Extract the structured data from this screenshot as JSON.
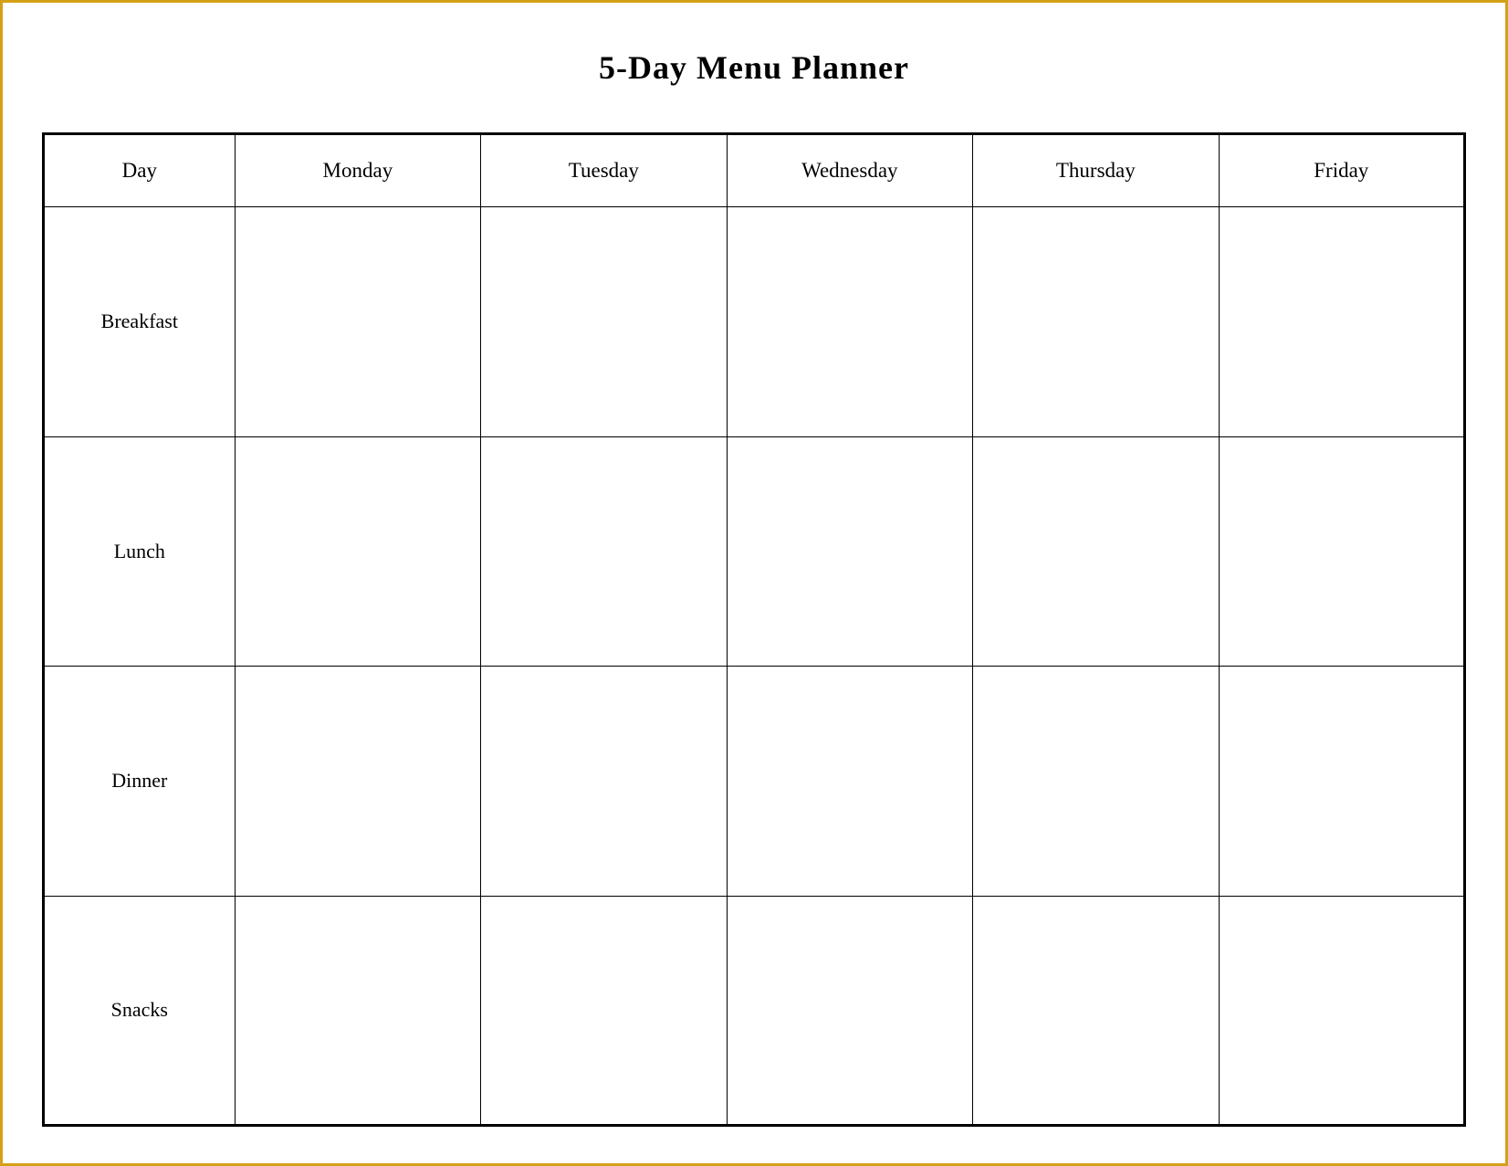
{
  "title": "5-Day Menu Planner",
  "columns": {
    "day_label": "Day",
    "days": [
      "Monday",
      "Tuesday",
      "Wednesday",
      "Thursday",
      "Friday"
    ]
  },
  "rows": [
    {
      "label": "Breakfast"
    },
    {
      "label": "Lunch"
    },
    {
      "label": "Dinner"
    },
    {
      "label": "Snacks"
    }
  ]
}
